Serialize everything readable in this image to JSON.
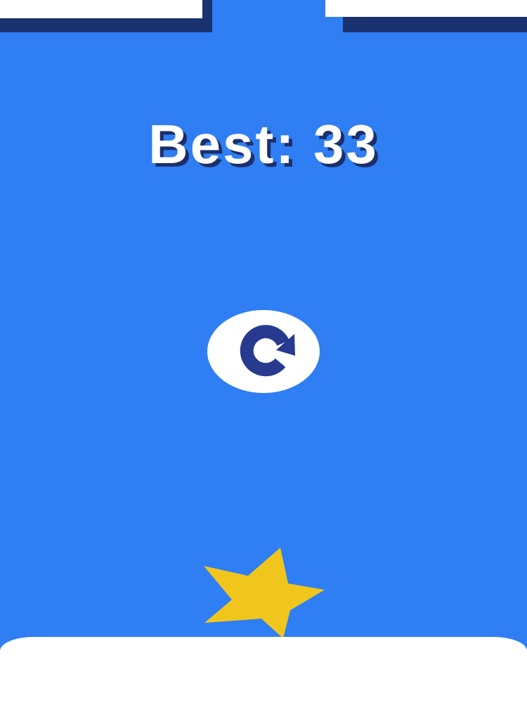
{
  "game": {
    "best_score_text": "Best: 33"
  },
  "controls": {
    "restart_icon": "restart-icon"
  },
  "colors": {
    "background": "#2f7ef3",
    "wall": "#ffffff",
    "wall_shadow": "#1a3270",
    "text": "#ffffff",
    "text_shadow": "#1b2f6b",
    "restart_arrow": "#283a8f",
    "star": "#f1c61c"
  }
}
